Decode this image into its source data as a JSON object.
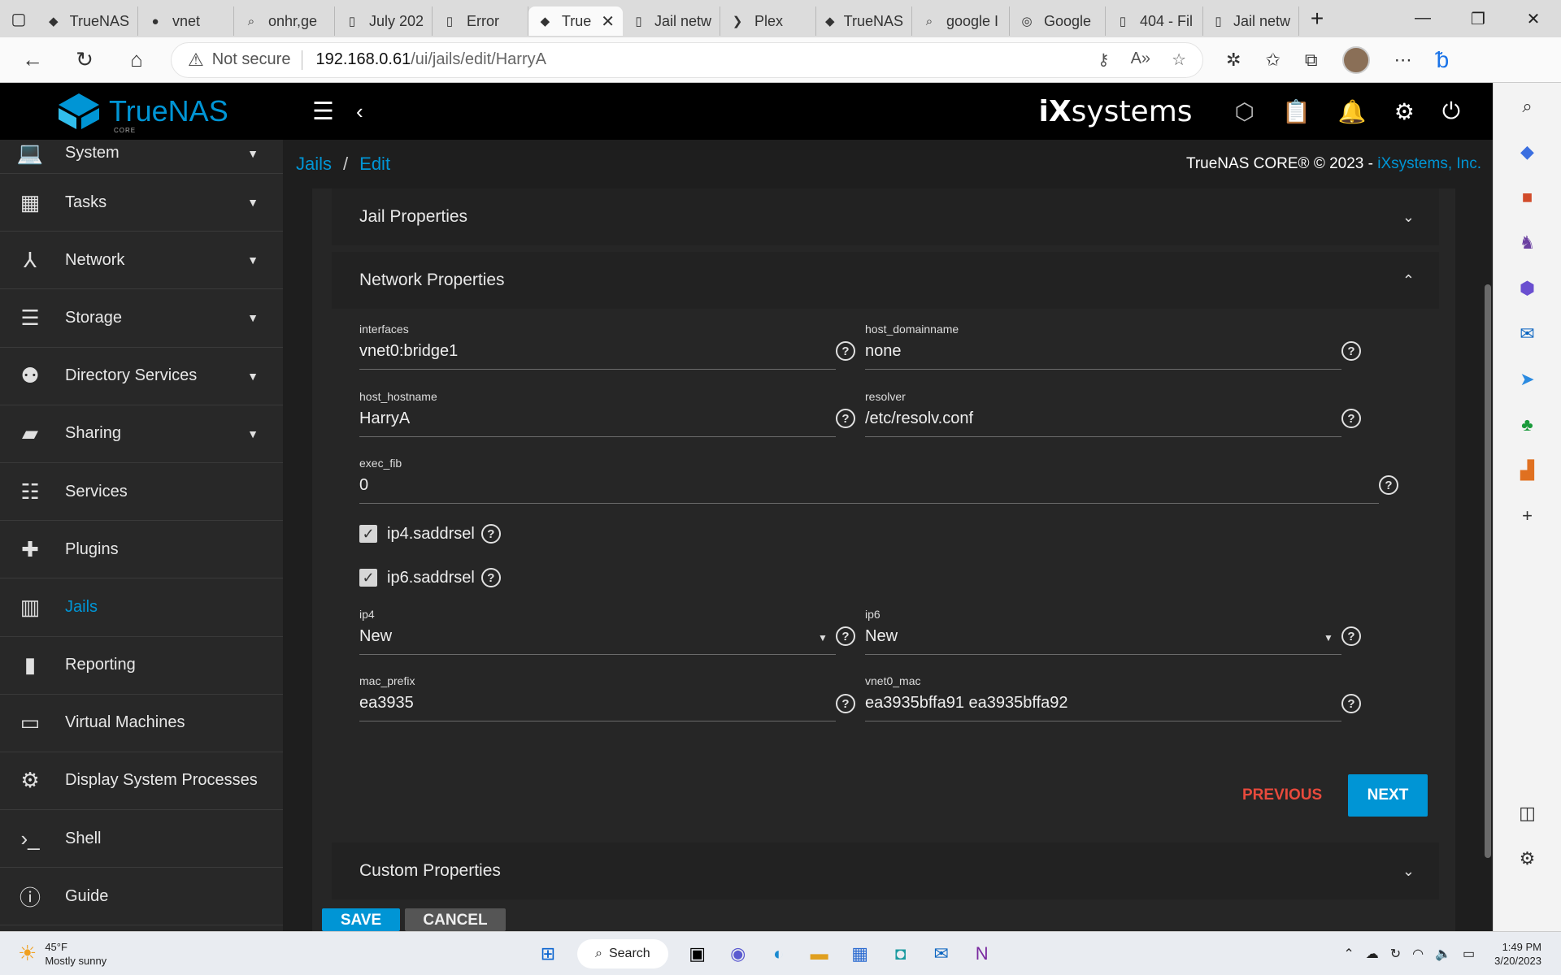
{
  "browser": {
    "tabs": [
      {
        "label": "TrueNAS",
        "icon": "truenas-icon"
      },
      {
        "label": "vnet",
        "icon": "app-icon"
      },
      {
        "label": "onhr,ge",
        "icon": "search-icon"
      },
      {
        "label": "July 202",
        "icon": "page-icon"
      },
      {
        "label": "Error",
        "icon": "page-icon"
      },
      {
        "label": "True",
        "icon": "truenas-icon",
        "active": true
      },
      {
        "label": "Jail netw",
        "icon": "page-icon"
      },
      {
        "label": "Plex",
        "icon": "plex-icon"
      },
      {
        "label": "TrueNAS",
        "icon": "truenas-icon"
      },
      {
        "label": "google I",
        "icon": "search-icon"
      },
      {
        "label": "Google",
        "icon": "google-lens-icon"
      },
      {
        "label": "404 - Fil",
        "icon": "page-icon"
      },
      {
        "label": "Jail netw",
        "icon": "page-icon"
      }
    ],
    "not_secure": "Not secure",
    "url_host": "192.168.0.61",
    "url_path": "/ui/jails/edit/HarryA"
  },
  "header": {
    "brand": "TrueNAS",
    "brand_sub": "CORE",
    "vendor": "systems"
  },
  "nav": [
    {
      "label": "System",
      "icon": "laptop-icon",
      "caret": true
    },
    {
      "label": "Tasks",
      "icon": "calendar-icon",
      "caret": true
    },
    {
      "label": "Network",
      "icon": "network-icon",
      "caret": true
    },
    {
      "label": "Storage",
      "icon": "storage-icon",
      "caret": true
    },
    {
      "label": "Directory Services",
      "icon": "directory-icon",
      "caret": true
    },
    {
      "label": "Sharing",
      "icon": "folder-share-icon",
      "caret": true
    },
    {
      "label": "Services",
      "icon": "tune-icon",
      "caret": false
    },
    {
      "label": "Plugins",
      "icon": "puzzle-icon",
      "caret": false
    },
    {
      "label": "Jails",
      "icon": "jail-icon",
      "caret": false,
      "active": true
    },
    {
      "label": "Reporting",
      "icon": "chart-icon",
      "caret": false
    },
    {
      "label": "Virtual Machines",
      "icon": "monitor-icon",
      "caret": false
    },
    {
      "label": "Display System Processes",
      "icon": "processes-icon",
      "caret": false
    },
    {
      "label": "Shell",
      "icon": "terminal-icon",
      "caret": false
    },
    {
      "label": "Guide",
      "icon": "info-icon",
      "caret": false
    }
  ],
  "breadcrumb": {
    "root": "Jails",
    "sep": "/",
    "current": "Edit"
  },
  "copyright": {
    "text": "TrueNAS CORE® © 2023 - ",
    "link": "iXsystems, Inc."
  },
  "form": {
    "jail_properties": "Jail Properties",
    "network_properties": "Network Properties",
    "custom_properties": "Custom Properties",
    "interfaces": {
      "label": "interfaces",
      "value": "vnet0:bridge1"
    },
    "host_domainname": {
      "label": "host_domainname",
      "value": "none"
    },
    "host_hostname": {
      "label": "host_hostname",
      "value": "HarryA"
    },
    "resolver": {
      "label": "resolver",
      "value": "/etc/resolv.conf"
    },
    "exec_fib": {
      "label": "exec_fib",
      "value": "0"
    },
    "ip4_saddrsel": {
      "label": "ip4.saddrsel",
      "checked": true
    },
    "ip6_saddrsel": {
      "label": "ip6.saddrsel",
      "checked": true
    },
    "ip4": {
      "label": "ip4",
      "value": "New"
    },
    "ip6": {
      "label": "ip6",
      "value": "New"
    },
    "mac_prefix": {
      "label": "mac_prefix",
      "value": "ea3935"
    },
    "vnet0_mac": {
      "label": "vnet0_mac",
      "value": "ea3935bffa91 ea3935bffa92"
    },
    "previous": "PREVIOUS",
    "next": "NEXT",
    "save": "SAVE",
    "cancel": "CANCEL"
  },
  "taskbar": {
    "temp": "45°F",
    "weather": "Mostly sunny",
    "search": "Search",
    "time": "1:49 PM",
    "date": "3/20/2023"
  }
}
